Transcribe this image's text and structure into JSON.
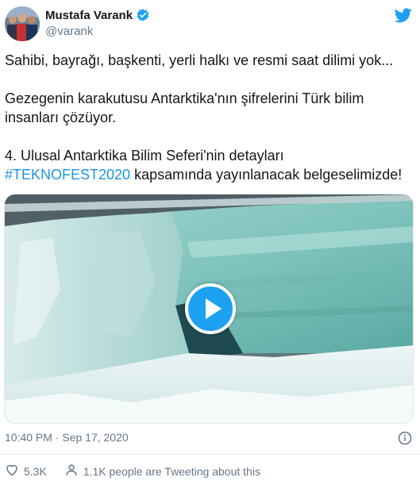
{
  "tweet": {
    "author_name": "Mustafa Varank",
    "handle": "@varank",
    "lines": [
      "Sahibi, bayrağı, başkenti, yerli halkı ve resmi saat dilimi yok...",
      "Gezegenin karakutusu Antarktika'nın şifrelerini Türk bilim",
      "insanları çözüyor.",
      "4. Ulusal Antarktika Bilim Seferi'nin detayları",
      "#TEKNOFEST2020",
      " kapsamında yayınlanacak belgeselimizde!"
    ],
    "timestamp": "10:40 PM · Sep 17, 2020",
    "likes": "5.3K",
    "tweeting_about": "1.1K people are Tweeting about this"
  },
  "colors": {
    "accent": "#1da1f2",
    "hashtag": "#1b95e0",
    "secondary_text": "#657786"
  },
  "icons": {
    "verified": "verified-badge-icon",
    "brand": "twitter-bird-icon",
    "info": "info-icon",
    "like": "heart-icon",
    "people": "person-icon",
    "play": "play-icon"
  }
}
